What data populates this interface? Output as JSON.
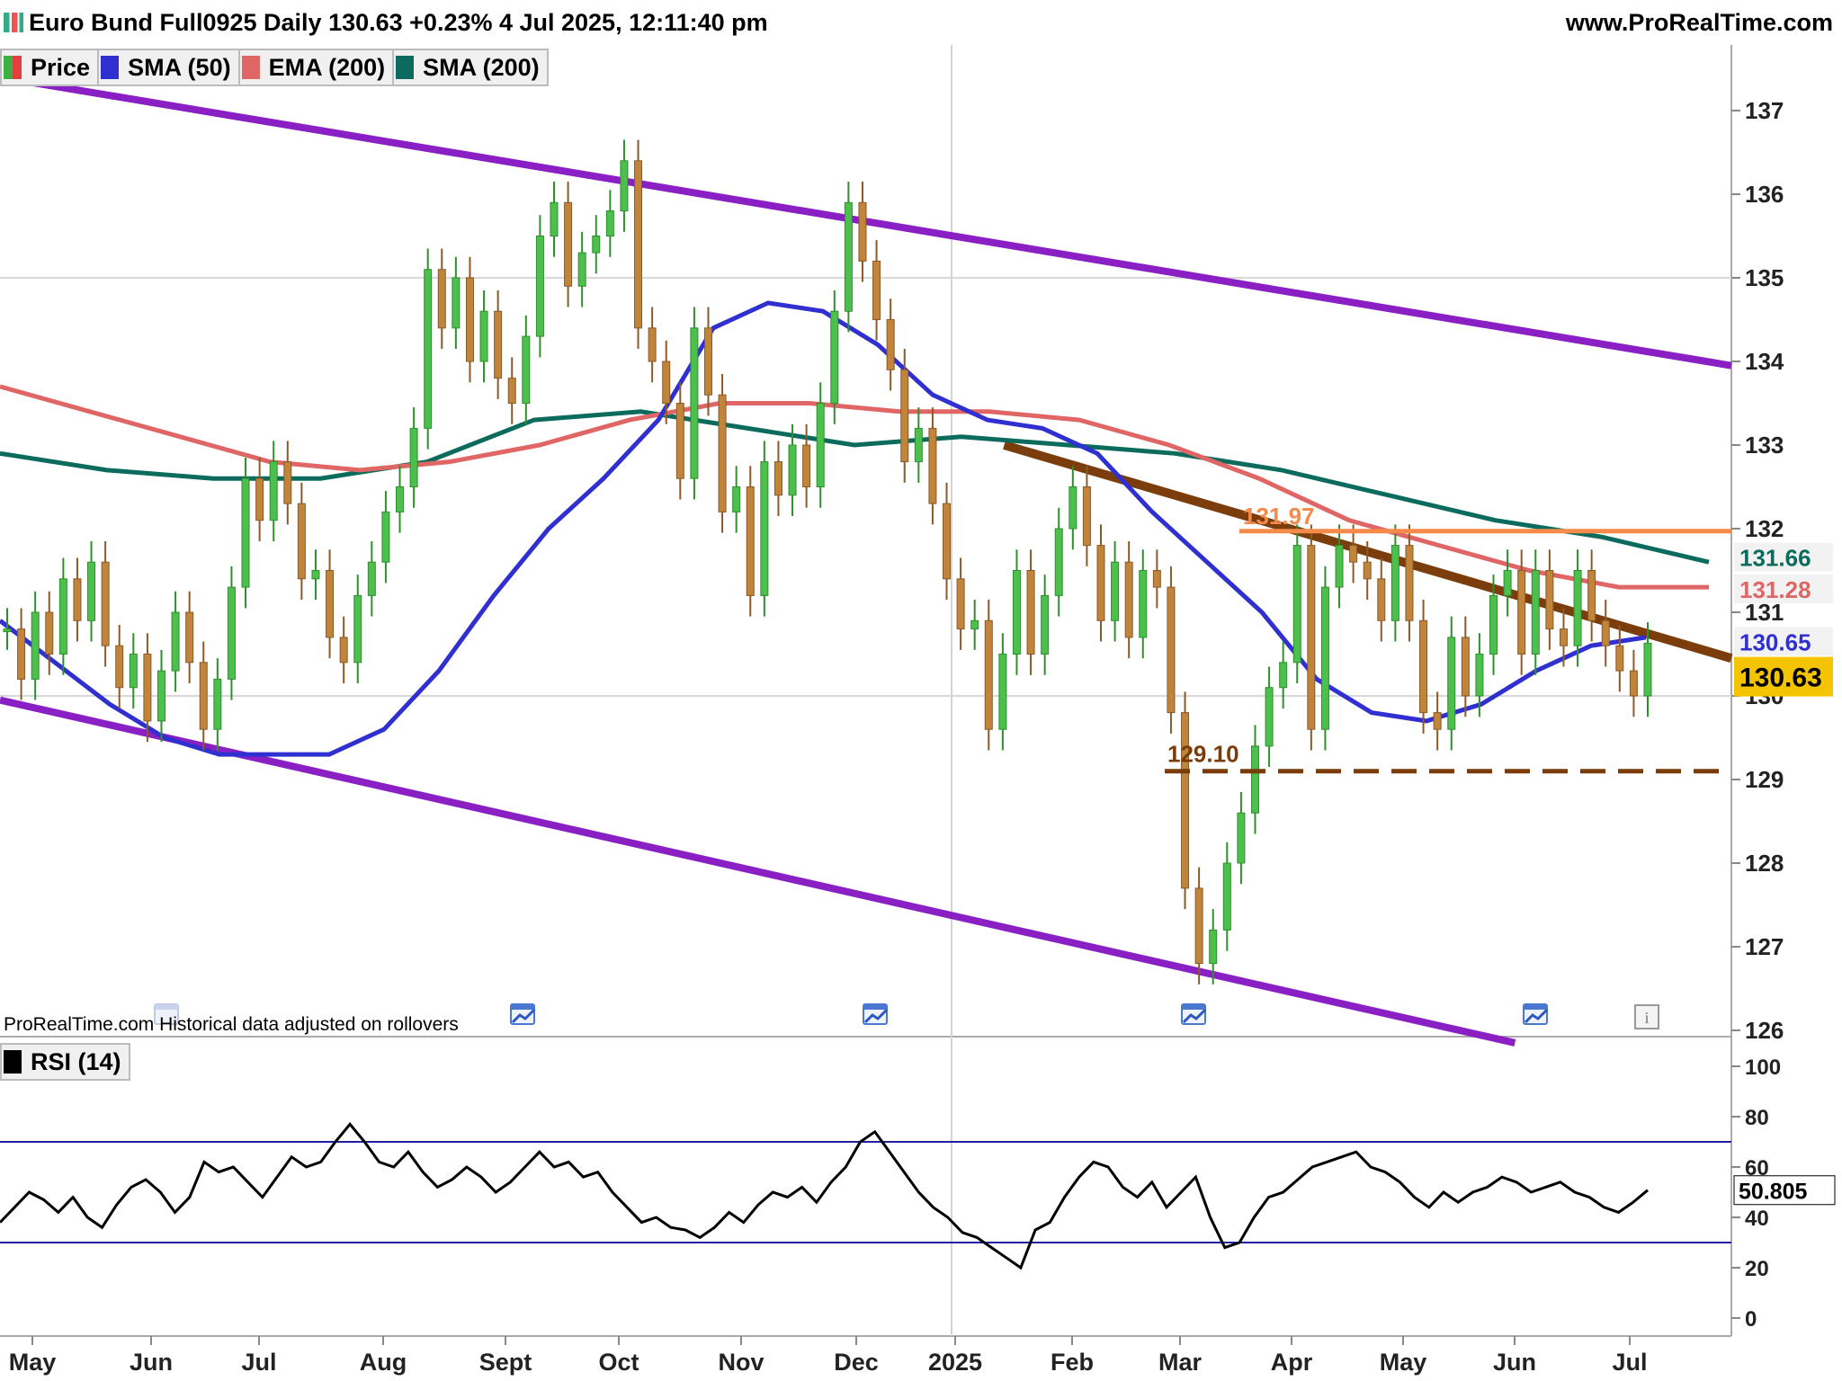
{
  "header": {
    "title": "Euro Bund Full0925 Daily 130.63 +0.23% 4 Jul 2025, 12:11:40 pm",
    "site": "www.ProRealTime.com"
  },
  "legend": [
    {
      "label": "Price",
      "color": "#2ca02c"
    },
    {
      "label": "SMA (50)",
      "color": "#3030d0"
    },
    {
      "label": "EMA (200)",
      "color": "#e06666"
    },
    {
      "label": "SMA (200)",
      "color": "#0b6b5d"
    }
  ],
  "note": "ProRealTime.com  Historical data adjusted on rollovers",
  "rsi_label": "RSI (14)",
  "chart_data": [
    {
      "type": "line",
      "title": "Euro Bund Full0925 Daily",
      "x_ticks": [
        "May",
        "Jun",
        "Jul",
        "Aug",
        "Sept",
        "Oct",
        "Nov",
        "Dec",
        "2025",
        "Feb",
        "Mar",
        "Apr",
        "May",
        "Jun",
        "Jul"
      ],
      "y_ticks": [
        126,
        127,
        128,
        129,
        130,
        131,
        132,
        133,
        134,
        135,
        136,
        137
      ],
      "ylim": [
        125.8,
        137.6
      ],
      "grid_lines": [
        130,
        135
      ],
      "last_price": 130.63,
      "change_pct": "+0.23%",
      "date": "4 Jul 2025, 12:11:40 pm",
      "closes": [
        130.8,
        130.2,
        131.0,
        130.5,
        131.4,
        130.9,
        131.6,
        130.6,
        130.1,
        130.5,
        129.7,
        130.3,
        131.0,
        130.4,
        129.6,
        130.2,
        131.3,
        132.6,
        132.1,
        132.8,
        132.3,
        131.4,
        131.5,
        130.7,
        130.4,
        131.2,
        131.6,
        132.2,
        132.5,
        133.2,
        135.1,
        134.4,
        135.0,
        134.0,
        134.6,
        133.8,
        133.5,
        134.3,
        135.5,
        135.9,
        134.9,
        135.3,
        135.5,
        135.8,
        136.4,
        134.4,
        134.0,
        133.5,
        132.6,
        134.4,
        133.6,
        132.2,
        132.5,
        131.2,
        132.8,
        132.4,
        133.0,
        132.5,
        133.5,
        134.6,
        135.9,
        135.2,
        134.5,
        133.9,
        132.8,
        133.2,
        132.3,
        131.4,
        130.8,
        130.9,
        129.6,
        130.5,
        131.5,
        130.5,
        131.2,
        132.0,
        132.5,
        131.8,
        130.9,
        131.6,
        130.7,
        131.5,
        131.3,
        129.8,
        127.7,
        126.8,
        127.2,
        128.0,
        128.6,
        129.4,
        130.1,
        130.4,
        131.8,
        129.6,
        131.3,
        131.8,
        131.6,
        131.4,
        130.9,
        131.8,
        130.9,
        129.8,
        129.6,
        130.7,
        130.0,
        130.5,
        131.2,
        131.5,
        130.5,
        131.5,
        130.8,
        130.6,
        131.5,
        130.9,
        130.6,
        130.3,
        130.0,
        130.63
      ],
      "annotations": [
        {
          "text": "131.97",
          "value": 131.97,
          "color": "#f58a4a"
        },
        {
          "text": "129.10",
          "value": 129.1,
          "color": "#7a3d0a"
        }
      ],
      "series_end_labels": [
        {
          "series": "SMA (200)",
          "value": "131.66",
          "color": "#0b6b5d"
        },
        {
          "series": "EMA (200)",
          "value": "131.28",
          "color": "#e06666"
        },
        {
          "series": "SMA (50)",
          "value": "130.65",
          "color": "#3030d0"
        },
        {
          "series": "Price",
          "value": "130.63",
          "color": "#f5c400"
        }
      ],
      "sma50": [
        130.9,
        130.4,
        129.9,
        129.5,
        129.3,
        129.3,
        129.3,
        129.6,
        130.3,
        131.2,
        132.0,
        132.6,
        133.3,
        134.4,
        134.7,
        134.6,
        134.2,
        133.6,
        133.3,
        133.2,
        132.9,
        132.2,
        131.6,
        131.0,
        130.2,
        129.8,
        129.7,
        129.9,
        130.3,
        130.6,
        130.7
      ],
      "ema200": [
        133.7,
        133.4,
        133.1,
        132.8,
        132.7,
        132.8,
        133.0,
        133.3,
        133.5,
        133.5,
        133.4,
        133.4,
        133.3,
        133.0,
        132.6,
        132.1,
        131.8,
        131.5,
        131.3,
        131.3
      ],
      "sma200": [
        132.9,
        132.7,
        132.6,
        132.6,
        132.8,
        133.3,
        133.4,
        133.2,
        133.0,
        133.1,
        133.0,
        132.9,
        132.7,
        132.4,
        132.1,
        131.9,
        131.6
      ],
      "channel_upper": [
        [
          0,
          137.4
        ],
        [
          1.0,
          133.95
        ]
      ],
      "channel_lower": [
        [
          0,
          129.95
        ],
        [
          0.875,
          125.85
        ]
      ],
      "trendline": [
        [
          0.58,
          133.0
        ],
        [
          1.0,
          130.45
        ]
      ]
    },
    {
      "type": "line",
      "title": "RSI (14)",
      "y_ticks": [
        0,
        20,
        40,
        60,
        80,
        100
      ],
      "ylim": [
        0,
        100
      ],
      "levels": [
        30,
        70
      ],
      "last_value": "50.805",
      "values": [
        38,
        44,
        50,
        47,
        42,
        48,
        40,
        36,
        45,
        52,
        55,
        50,
        42,
        48,
        62,
        58,
        60,
        54,
        48,
        56,
        64,
        60,
        62,
        70,
        77,
        70,
        62,
        60,
        66,
        58,
        52,
        55,
        60,
        56,
        50,
        54,
        60,
        66,
        60,
        62,
        56,
        58,
        50,
        44,
        38,
        40,
        36,
        35,
        32,
        36,
        42,
        38,
        45,
        50,
        48,
        52,
        46,
        54,
        60,
        70,
        74,
        66,
        58,
        50,
        44,
        40,
        34,
        32,
        28,
        24,
        20,
        35,
        38,
        48,
        56,
        62,
        60,
        52,
        48,
        54,
        44,
        50,
        56,
        40,
        28,
        30,
        40,
        48,
        50,
        55,
        60,
        62,
        64,
        66,
        60,
        58,
        54,
        48,
        44,
        50,
        46,
        50,
        52,
        56,
        54,
        50,
        52,
        54,
        50,
        48,
        44,
        42,
        46,
        50.805
      ]
    }
  ]
}
